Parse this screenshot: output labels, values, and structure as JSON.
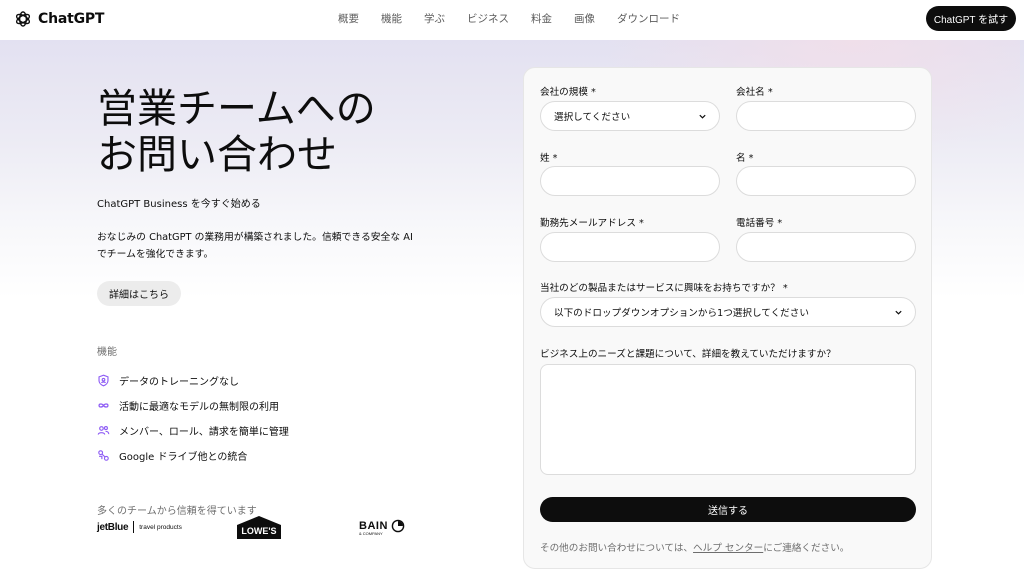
{
  "nav": {
    "logo_text": "ChatGPT",
    "links": [
      "概要",
      "機能",
      "学ぶ",
      "ビジネス",
      "料金",
      "画像",
      "ダウンロード"
    ],
    "cta": "ChatGPT を試す"
  },
  "hero": {
    "title_line1": "営業チームへの",
    "title_line2": "お問い合わせ",
    "subtitle": "ChatGPT Business を今すぐ始める",
    "description": "おなじみの ChatGPT の業務用が構築されました。信頼できる安全な AI でチームを強化できます。",
    "details_button": "詳細はこちら"
  },
  "features": {
    "heading": "機能",
    "items": [
      {
        "label": "データのトレーニングなし",
        "icon": "shield-lock-icon"
      },
      {
        "label": "活動に最適なモデルの無制限の利用",
        "icon": "infinity-icon"
      },
      {
        "label": "メンバー、ロール、請求を簡単に管理",
        "icon": "users-icon"
      },
      {
        "label": "Google ドライブ他との統合",
        "icon": "integration-icon"
      }
    ]
  },
  "trust": {
    "heading": "多くのチームから信頼を得ています",
    "logos": [
      {
        "name": "jetBlue",
        "suffix": "travel products"
      },
      {
        "name": "LOWE'S"
      },
      {
        "name": "BAIN",
        "suffix": "& COMPANY"
      }
    ]
  },
  "form": {
    "company_size_label": "会社の規模 *",
    "company_size_value": "選択してください",
    "company_name_label": "会社名 *",
    "last_name_label": "姓 *",
    "first_name_label": "名 *",
    "email_label": "勤務先メールアドレス *",
    "phone_label": "電話番号 *",
    "product_label": "当社のどの製品またはサービスに興味をお持ちですか？ *",
    "product_value": "以下のドロップダウンオプションから1つ選択してください",
    "needs_label": "ビジネス上のニーズと課題について、詳細を教えていただけますか？",
    "submit": "送信する",
    "footer_prefix": "その他のお問い合わせについては、",
    "footer_link": "ヘルプ センター",
    "footer_suffix": "にご連絡ください。"
  },
  "colors": {
    "accent": "#8e5cf5",
    "primary": "#0d0d0d"
  }
}
